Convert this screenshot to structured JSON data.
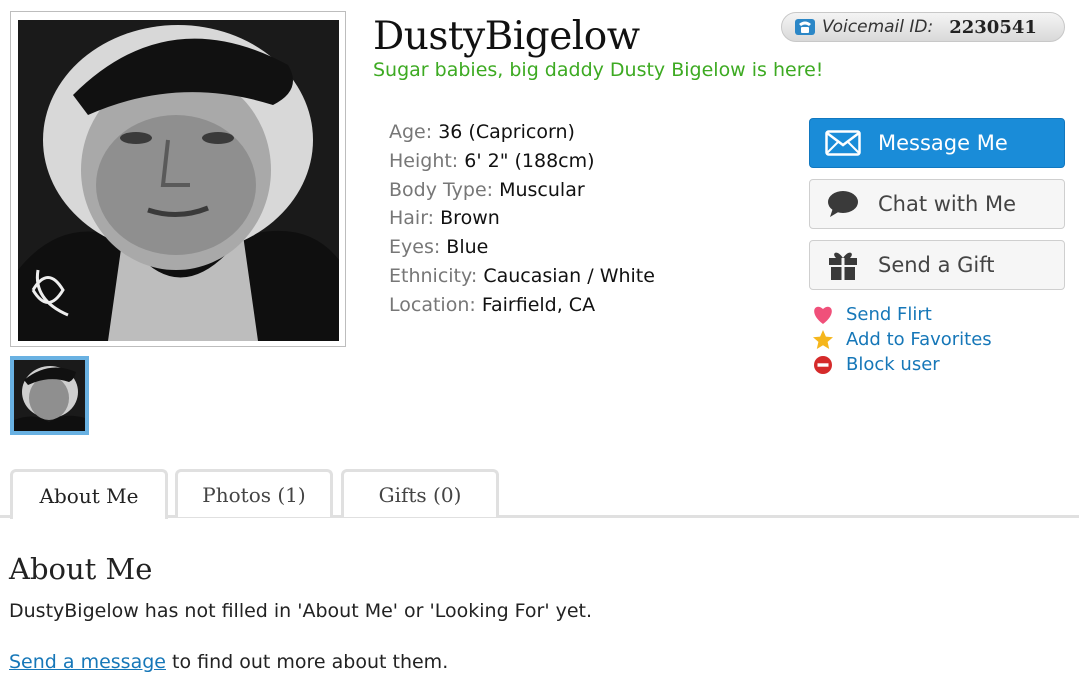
{
  "profile": {
    "username": "DustyBigelow",
    "tagline": "Sugar babies, big daddy Dusty Bigelow is here!",
    "voicemail_label": "Voicemail ID:",
    "voicemail_id": "2230541"
  },
  "details": [
    {
      "label": "Age:",
      "value": "36 (Capricorn)"
    },
    {
      "label": "Height:",
      "value": "6' 2\" (188cm)"
    },
    {
      "label": "Body Type:",
      "value": "Muscular"
    },
    {
      "label": "Hair:",
      "value": "Brown"
    },
    {
      "label": "Eyes:",
      "value": "Blue"
    },
    {
      "label": "Ethnicity:",
      "value": "Caucasian / White"
    },
    {
      "label": "Location:",
      "value": "Fairfield, CA"
    }
  ],
  "actions": {
    "message": "Message Me",
    "chat": "Chat with Me",
    "gift": "Send a Gift",
    "flirt": "Send Flirt",
    "favorites": "Add to Favorites",
    "block": "Block user"
  },
  "tabs": [
    {
      "label": "About Me",
      "active": true
    },
    {
      "label": "Photos (1)",
      "active": false
    },
    {
      "label": "Gifts (0)",
      "active": false
    }
  ],
  "about": {
    "heading": "About Me",
    "text": "DustyBigelow has not filled in 'About Me' or 'Looking For' yet.",
    "link_text": "Send a message",
    "cta_suffix": " to find out more about them."
  },
  "icons": {
    "voicemail": "phone-icon",
    "message": "envelope-icon",
    "chat": "speech-bubble-icon",
    "gift": "gift-icon",
    "flirt": "heart-icon",
    "favorites": "star-icon",
    "block": "block-icon"
  },
  "colors": {
    "accent": "#1a8cd8",
    "tagline": "#3daa22",
    "link": "#1677b8",
    "thumb_border": "#69b1e2",
    "heart": "#f0507a",
    "star": "#f5b61c",
    "block": "#d52a2a"
  }
}
